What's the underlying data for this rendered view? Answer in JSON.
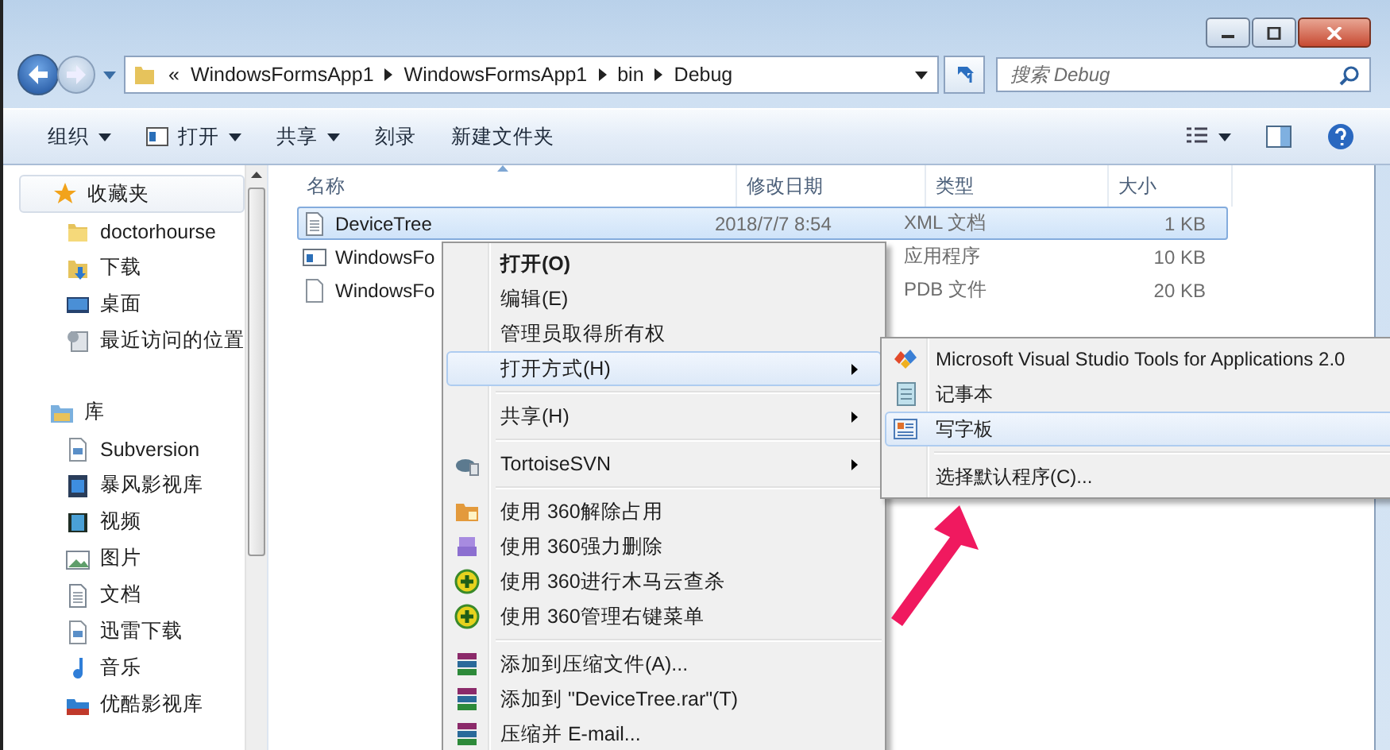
{
  "address_bar": {
    "overflow": "«",
    "path": [
      "WindowsFormsApp1",
      "WindowsFormsApp1",
      "bin",
      "Debug"
    ]
  },
  "search": {
    "placeholder": "搜索 Debug"
  },
  "toolbar": [
    {
      "label": "组织",
      "dropdown": true
    },
    {
      "label": "打开",
      "dropdown": true
    },
    {
      "label": "共享",
      "dropdown": true
    },
    {
      "label": "刻录",
      "dropdown": false
    },
    {
      "label": "新建文件夹",
      "dropdown": false
    }
  ],
  "navigation": {
    "favorites": {
      "label": "收藏夹",
      "items": [
        {
          "label": "doctorhourse"
        },
        {
          "label": "下载"
        },
        {
          "label": "桌面"
        },
        {
          "label": "最近访问的位置"
        }
      ]
    },
    "libraries": {
      "label": "库",
      "items": [
        {
          "label": "Subversion"
        },
        {
          "label": "暴风影视库"
        },
        {
          "label": "视频"
        },
        {
          "label": "图片"
        },
        {
          "label": "文档"
        },
        {
          "label": "迅雷下载"
        },
        {
          "label": "音乐"
        },
        {
          "label": "优酷影视库"
        }
      ]
    }
  },
  "files": {
    "columns": [
      "名称",
      "修改日期",
      "类型",
      "大小"
    ],
    "rows": [
      {
        "name": "DeviceTree",
        "date": "2018/7/7 8:54",
        "type": "XML 文档",
        "size": "1 KB",
        "selected": true
      },
      {
        "name": "WindowsFo",
        "type": "应用程序",
        "size": "10 KB",
        "selected": false
      },
      {
        "name": "WindowsFo",
        "type": "PDB 文件",
        "size": "20 KB",
        "selected": false
      }
    ]
  },
  "context_menu": {
    "items": [
      {
        "kind": "item",
        "label": "打开(O)",
        "default": true,
        "submenu": false,
        "selected": false
      },
      {
        "kind": "item",
        "label": "编辑(E)",
        "default": false,
        "submenu": false,
        "selected": false
      },
      {
        "kind": "item",
        "label": "管理员取得所有权",
        "default": false,
        "submenu": false,
        "selected": false
      },
      {
        "kind": "item",
        "label": "打开方式(H)",
        "default": false,
        "submenu": true,
        "selected": true
      },
      {
        "kind": "separator"
      },
      {
        "kind": "item",
        "label": "共享(H)",
        "default": false,
        "submenu": true,
        "selected": false
      },
      {
        "kind": "separator"
      },
      {
        "kind": "item",
        "label": "TortoiseSVN",
        "default": false,
        "submenu": true,
        "selected": false
      },
      {
        "kind": "separator"
      },
      {
        "kind": "item",
        "label": "使用 360解除占用",
        "default": false,
        "submenu": false,
        "selected": false
      },
      {
        "kind": "item",
        "label": "使用 360强力删除",
        "default": false,
        "submenu": false,
        "selected": false
      },
      {
        "kind": "item",
        "label": "使用 360进行木马云查杀",
        "default": false,
        "submenu": false,
        "selected": false
      },
      {
        "kind": "item",
        "label": "使用 360管理右键菜单",
        "default": false,
        "submenu": false,
        "selected": false
      },
      {
        "kind": "separator"
      },
      {
        "kind": "item",
        "label": "添加到压缩文件(A)...",
        "default": false,
        "submenu": false,
        "selected": false
      },
      {
        "kind": "item",
        "label": "添加到 \"DeviceTree.rar\"(T)",
        "default": false,
        "submenu": false,
        "selected": false
      },
      {
        "kind": "item",
        "label": "压缩并 E-mail...",
        "default": false,
        "submenu": false,
        "selected": false
      }
    ]
  },
  "submenu": {
    "items": [
      {
        "kind": "item",
        "label": "Microsoft Visual Studio Tools for Applications 2.0",
        "selected": false
      },
      {
        "kind": "item",
        "label": "记事本",
        "selected": false
      },
      {
        "kind": "item",
        "label": "写字板",
        "selected": true
      },
      {
        "kind": "separator"
      },
      {
        "kind": "item",
        "label": "选择默认程序(C)...",
        "selected": false
      }
    ]
  }
}
